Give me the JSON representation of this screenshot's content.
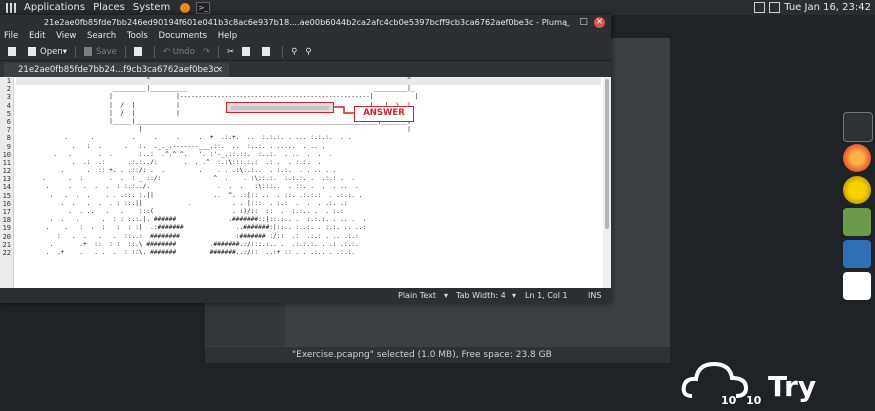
{
  "topbar": {
    "applications": "Applications",
    "places": "Places",
    "system": "System",
    "datetime": "Tue Jan 16, 23:42"
  },
  "window": {
    "title": "21e2ae0fb85fde7bb246ed90194f601e041b3c8ac6e937b18....ae00b6044b2ca2afc4cb0e5397bcff9cb3ca6762aef0be3c - Pluma",
    "menu": [
      "File",
      "Edit",
      "View",
      "Search",
      "Tools",
      "Documents",
      "Help"
    ],
    "toolbar": {
      "open": "Open",
      "save": "Save",
      "undo": "Undo"
    },
    "tab_label": "21e2ae0fb85fde7bb24...f9cb3ca6762aef0be3c",
    "line_numbers": [
      "1",
      "2",
      "3",
      "4",
      "5",
      "6",
      "7",
      "8",
      "9",
      "10",
      "11",
      "12",
      "13",
      "14",
      "15",
      "16",
      "17",
      "18",
      "19",
      "20",
      "21",
      "22"
    ],
    "lines": [
      "                                   ^                                                                     ^",
      "                          _________|__________                                                  _________|_",
      "                         |                 |---------------------------------------------------|           |",
      "                         |  /  |           |                                                   |   |  \\  |",
      "                         |  /  |           |                                                   |   |  \\  |",
      "                         |_____|_________________________________________________________________|_______|",
      "                                 |                                                                       |",
      "             .      .          .     .     .     .  +  .:.+.  ..  :.:.:. . ... :.:.:.  . .",
      "               .   :  .      .   :.  ._._.-------___.::.  ..  :..:. . .....  . .. .",
      "          .   .       .  .       :..:  .^.^ ^.   '. :'-_.::.::.  :..:.  . ..  .  .  .",
      "               .  .:  .:      .:.:../:       .  . .^  :.:\\:::.:.:  .: .  . :.:.  .",
      "            .      .  :: +. . .::/: .  .         .    . . .:\\:.:..  . :.:.  . . .. . .",
      "       .      .  :       .  .  : _ ::/:              ^  .    . :\\::.:.  :.:.:. .  .:.: .  .",
      "        .     .   .  .  .  : :.:../.                  .  .  .   :\\:::..  . ::. .  .  . ..  .",
      "         .   .  .  .    . . .::. :.||                ..  ^. .:|:: ..  . ::. .:.:.:  . .:.:. .",
      "            .  .   .  .  . : ::.||            .           . . |:::  . :.:  .  .  . .:. .:",
      "              .  . ..   .   .    :::(                     . :)/::  ::  .  :.:.. .  . :.:",
      "         .  .   .      .  : : :.:.|. ######              .#######::|::.:.. .  :.:.:. . .. .  .",
      "        .    .   :  .  :   :  : :|  .:#######              ..#######:|::.. :..:. . :.:. .. ..:",
      "           :   .  .   .   .  ::..:  ########               :####### :/::  .:  .:.: . .. .:.:",
      "         .       .+  ::  : :  ::.\\ ########         .#######.:/:::.:.. .  .:.:.:. . .: .:.:.",
      "        .  .+    .   . .  .  : ::\\. #######         #######..:/::  ..:+ :: . . .:.. . .:.:."
    ],
    "answer_label": "ANSWER",
    "status": {
      "syntax": "Plain Text",
      "tab_width": "Tab Width: 4",
      "position": "Ln 1, Col 1",
      "mode": "INS"
    }
  },
  "background_window": {
    "status": "\"Exercise.pcapng\" selected (1.0 MB), Free space: 23.8 GB"
  },
  "logo": {
    "text": "Try",
    "n1": "10",
    "n2": "10"
  },
  "colors": {
    "highlight": "#d0232a",
    "panel": "#2b2e32"
  }
}
